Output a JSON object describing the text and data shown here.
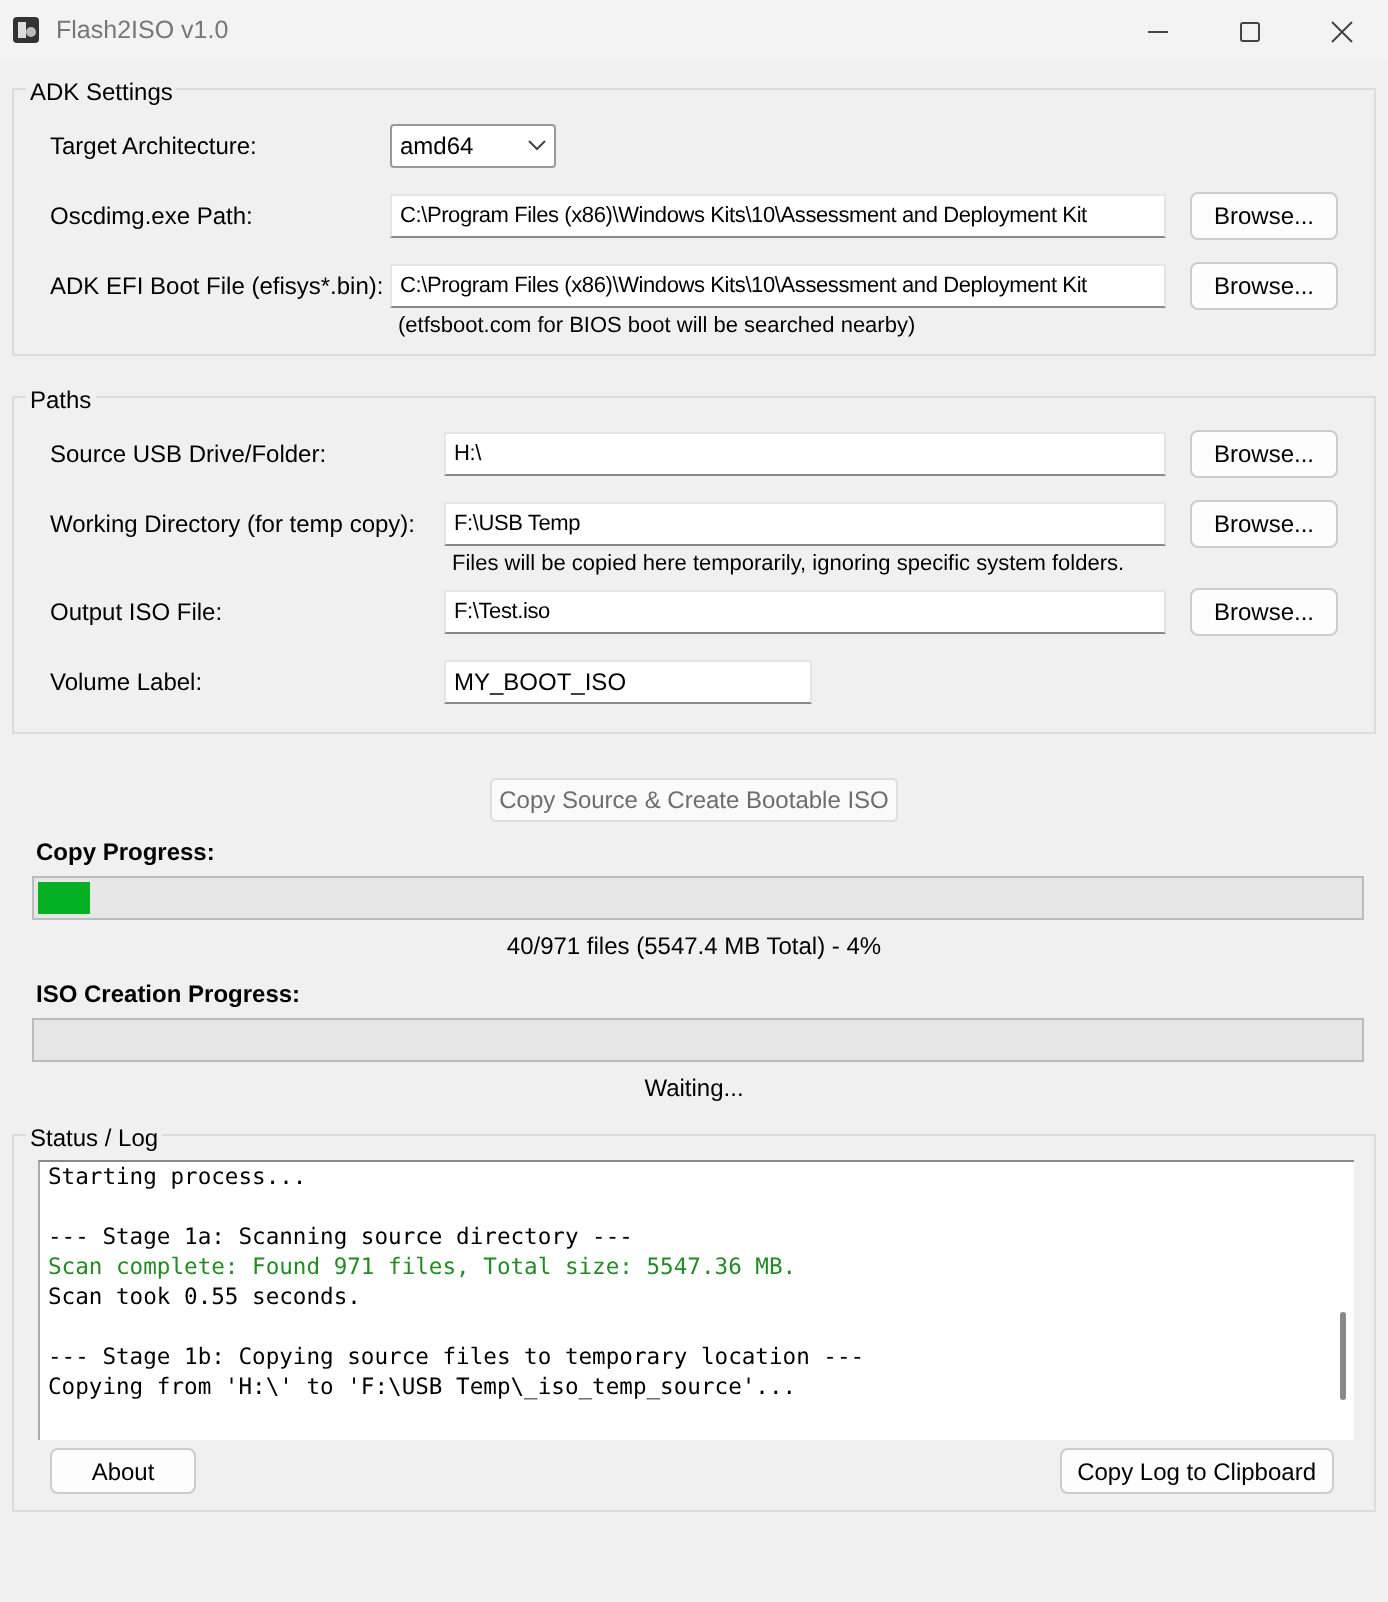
{
  "window": {
    "title": "Flash2ISO v1.0"
  },
  "adk_settings": {
    "title": "ADK Settings",
    "rows": [
      {
        "kind": "combo",
        "label": "Target Architecture:",
        "value": "amd64"
      },
      {
        "kind": "path",
        "label": "Oscdimg.exe Path:",
        "value": "C:\\Program Files (x86)\\Windows Kits\\10\\Assessment and Deployment Kit",
        "button": "Browse..."
      },
      {
        "kind": "path",
        "label": "ADK EFI Boot File (efisys*.bin):",
        "value": "C:\\Program Files (x86)\\Windows Kits\\10\\Assessment and Deployment Kit",
        "button": "Browse...",
        "note": "(etfsboot.com for BIOS boot will be searched nearby)"
      }
    ]
  },
  "paths": {
    "title": "Paths",
    "rows": [
      {
        "kind": "path",
        "label": "Source USB Drive/Folder:",
        "value": "H:\\",
        "button": "Browse..."
      },
      {
        "kind": "path",
        "label": "Working Directory (for temp copy):",
        "value": "F:\\USB Temp",
        "button": "Browse...",
        "note": "Files will be copied here temporarily, ignoring specific system folders."
      },
      {
        "kind": "path",
        "label": "Output ISO File:",
        "value": "F:\\Test.iso",
        "button": "Browse..."
      },
      {
        "kind": "text",
        "label": "Volume Label:",
        "value": "MY_BOOT_ISO"
      }
    ]
  },
  "start_button": {
    "label": "Copy Source & Create Bootable ISO",
    "disabled": true
  },
  "progress": [
    {
      "label": "Copy Progress:",
      "level": 0.04,
      "status": "40/971 files (5547.4 MB Total) - 4%"
    },
    {
      "label": "ISO Creation Progress:",
      "status": "Waiting..."
    }
  ],
  "status_log": {
    "title": "Status / Log",
    "blocks": [
      [
        {
          "kind": "info",
          "text": "Starting process..."
        }
      ],
      [
        {
          "kind": "info",
          "text": "--- Stage 1a: Scanning source directory ---"
        },
        {
          "kind": "success",
          "text": "Scan complete: Found 971 files, Total size: 5547.36 MB."
        },
        {
          "kind": "info",
          "text": "Scan took 0.55 seconds."
        }
      ],
      [
        {
          "kind": "info",
          "text": "--- Stage 1b: Copying source files to temporary location ---"
        },
        {
          "kind": "info",
          "text": "Copying from 'H:\\' to 'F:\\USB Temp\\_iso_temp_source'..."
        }
      ]
    ],
    "buttons": [
      "About",
      "Copy Log to Clipboard"
    ]
  }
}
